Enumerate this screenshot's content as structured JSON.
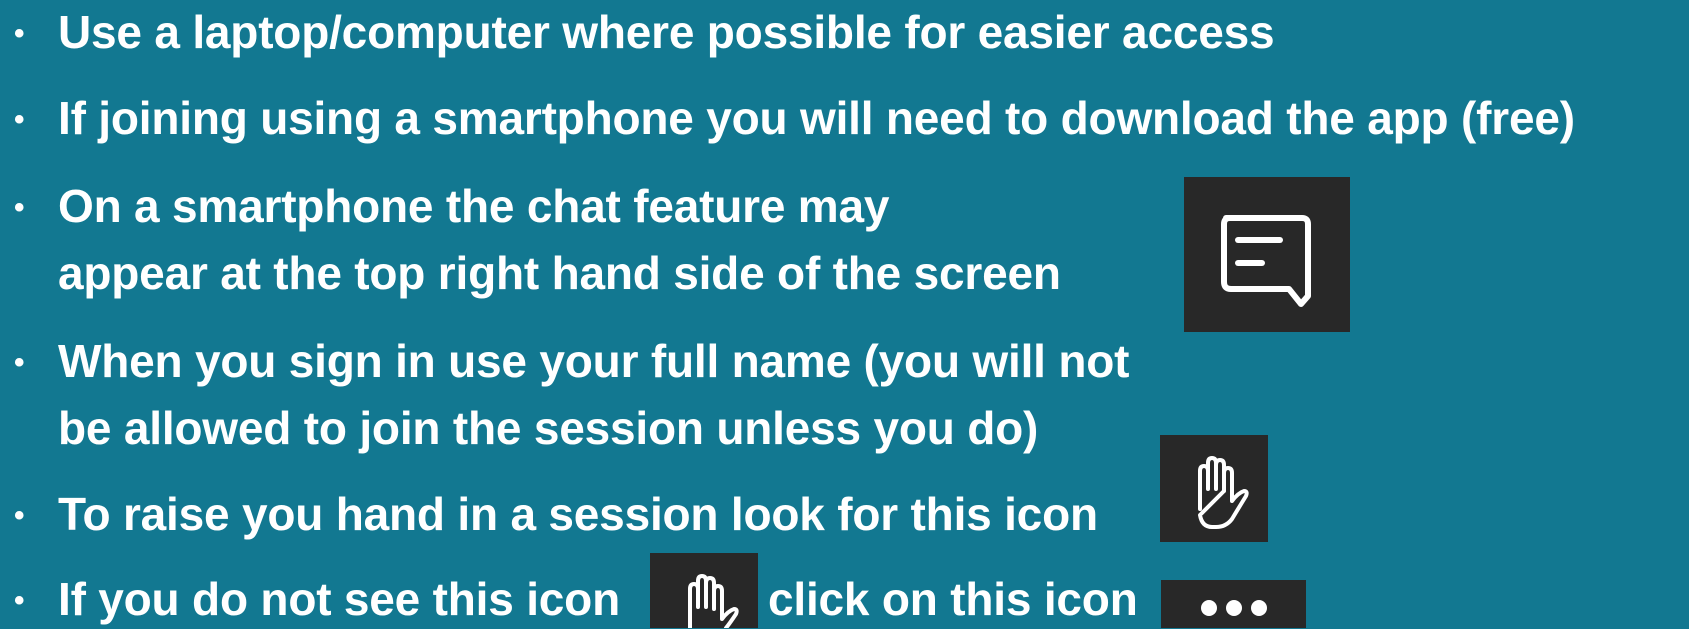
{
  "bullets": [
    {
      "lines": [
        "Use a laptop/computer where possible for easier access"
      ]
    },
    {
      "lines": [
        "If joining using a smartphone you will need to download the app (free)"
      ]
    },
    {
      "lines": [
        "On a smartphone the chat feature may",
        "appear at the top right hand side of the screen"
      ],
      "icon": "chat-icon"
    },
    {
      "lines": [
        "When you sign in use your full name (you will not",
        "be allowed to join the session unless you do)"
      ]
    },
    {
      "lines": [
        "To raise you hand in a session look for this icon"
      ],
      "icon": "raise-hand-icon"
    },
    {
      "lines": [
        "If you do not see this icon",
        "click on this icon"
      ],
      "icons": [
        "raise-hand-icon",
        "more-options-icon"
      ]
    }
  ],
  "bullet_char": "•",
  "colors": {
    "background": "#127891",
    "text": "#ffffff",
    "icon_background": "#282828"
  }
}
